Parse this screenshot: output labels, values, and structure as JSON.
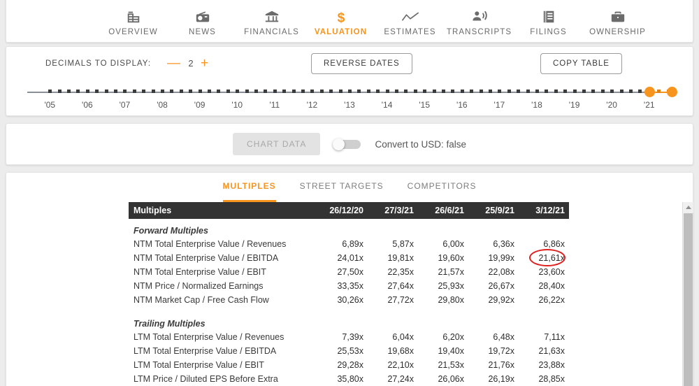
{
  "nav": {
    "items": [
      {
        "label": "OVERVIEW",
        "icon": "building-icon",
        "active": false
      },
      {
        "label": "NEWS",
        "icon": "radio-news-icon",
        "active": false
      },
      {
        "label": "FINANCIALS",
        "icon": "bank-icon",
        "active": false
      },
      {
        "label": "VALUATION",
        "icon": "dollar-icon",
        "active": true
      },
      {
        "label": "ESTIMATES",
        "icon": "line-chart-icon",
        "active": false
      },
      {
        "label": "TRANSCRIPTS",
        "icon": "speaker-person-icon",
        "active": false
      },
      {
        "label": "FILINGS",
        "icon": "document-icon",
        "active": false
      },
      {
        "label": "OWNERSHIP",
        "icon": "briefcase-icon",
        "active": false
      }
    ]
  },
  "controls": {
    "decimals_label": "DECIMALS TO DISPLAY:",
    "decimals_minus": "—",
    "decimals_value": "2",
    "decimals_plus": "+",
    "reverse_dates_label": "REVERSE DATES",
    "copy_table_label": "COPY TABLE"
  },
  "slider": {
    "years": [
      "'05",
      "'06",
      "'07",
      "'08",
      "'09",
      "'10",
      "'11",
      "'12",
      "'13",
      "'14",
      "'15",
      "'16",
      "'17",
      "'18",
      "'19",
      "'20",
      "'21"
    ],
    "selected_start_year": "'21",
    "selected_color": "#f7941e",
    "track_color": "#8a8e99"
  },
  "chart_bar": {
    "chart_data_label": "CHART DATA",
    "toggle_state": "off",
    "convert_label": "Convert to USD: false"
  },
  "tabs": [
    {
      "label": "MULTIPLES",
      "active": true
    },
    {
      "label": "STREET TARGETS",
      "active": false
    },
    {
      "label": "COMPETITORS",
      "active": false
    }
  ],
  "table": {
    "corner_label": "Multiples",
    "columns": [
      "26/12/20",
      "27/3/21",
      "26/6/21",
      "25/9/21",
      "3/12/21"
    ],
    "sections": [
      {
        "title": "Forward Multiples",
        "rows": [
          {
            "label": "NTM Total Enterprise Value / Revenues",
            "values": [
              "6,89x",
              "5,87x",
              "6,00x",
              "6,36x",
              "6,86x"
            ]
          },
          {
            "label": "NTM Total Enterprise Value / EBITDA",
            "values": [
              "24,01x",
              "19,81x",
              "19,60x",
              "19,99x",
              "21,61x"
            ],
            "highlight_index": 4
          },
          {
            "label": "NTM Total Enterprise Value / EBIT",
            "values": [
              "27,50x",
              "22,35x",
              "21,57x",
              "22,08x",
              "23,60x"
            ]
          },
          {
            "label": "NTM Price / Normalized Earnings",
            "values": [
              "33,35x",
              "27,64x",
              "25,93x",
              "26,67x",
              "28,40x"
            ]
          },
          {
            "label": "NTM Market Cap / Free Cash Flow",
            "values": [
              "30,26x",
              "27,72x",
              "29,80x",
              "29,92x",
              "26,22x"
            ]
          }
        ]
      },
      {
        "title": "Trailing Multiples",
        "rows": [
          {
            "label": "LTM Total Enterprise Value / Revenues",
            "values": [
              "7,39x",
              "6,04x",
              "6,20x",
              "6,48x",
              "7,11x"
            ]
          },
          {
            "label": "LTM Total Enterprise Value / EBITDA",
            "values": [
              "25,53x",
              "19,68x",
              "19,40x",
              "19,72x",
              "21,63x"
            ]
          },
          {
            "label": "LTM Total Enterprise Value / EBIT",
            "values": [
              "29,28x",
              "22,10x",
              "21,53x",
              "21,76x",
              "23,88x"
            ]
          },
          {
            "label": "LTM Price / Diluted EPS Before Extra",
            "values": [
              "35,80x",
              "27,24x",
              "26,06x",
              "26,19x",
              "28,85x"
            ]
          }
        ]
      }
    ],
    "highlight_color": "#e01f1f"
  }
}
